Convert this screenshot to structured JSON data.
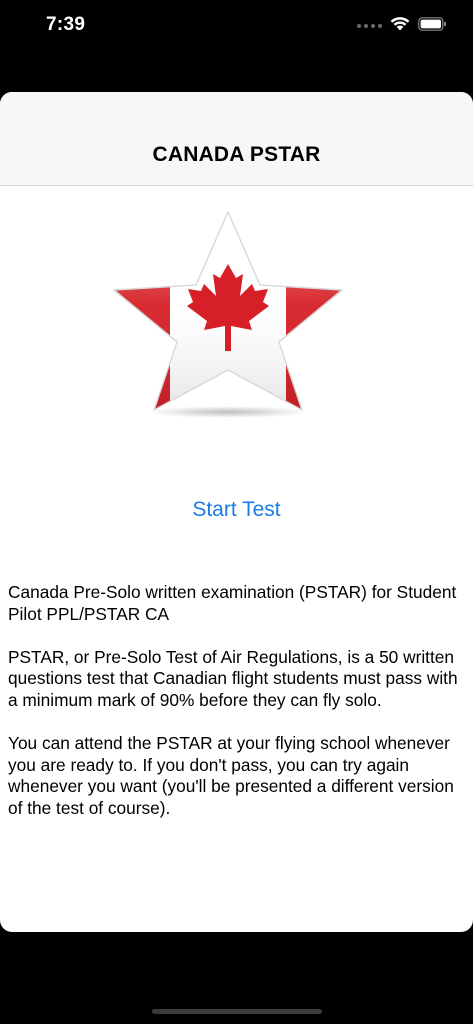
{
  "status_bar": {
    "time": "7:39",
    "icons": [
      "cellular-signal-icon",
      "wifi-icon",
      "battery-icon"
    ]
  },
  "nav": {
    "title": "CANADA PSTAR"
  },
  "hero": {
    "image": "canada-flag-star-icon",
    "colors": {
      "red": "#d61f26",
      "white": "#ffffff"
    }
  },
  "actions": {
    "start_label": "Start Test",
    "accent_color": "#1a7ce6"
  },
  "description": {
    "paragraphs": [
      "Canada Pre-Solo written examination (PSTAR) for Student Pilot PPL/PSTAR CA",
      "PSTAR, or Pre-Solo Test of Air Regulations, is a 50 written questions test that Canadian flight students must pass with a minimum mark of 90% before they can fly solo.",
      "You can attend the PSTAR at your flying school whenever you are ready to. If you don't pass, you can try again whenever you want (you'll be presented a different version of the test of course)."
    ]
  }
}
